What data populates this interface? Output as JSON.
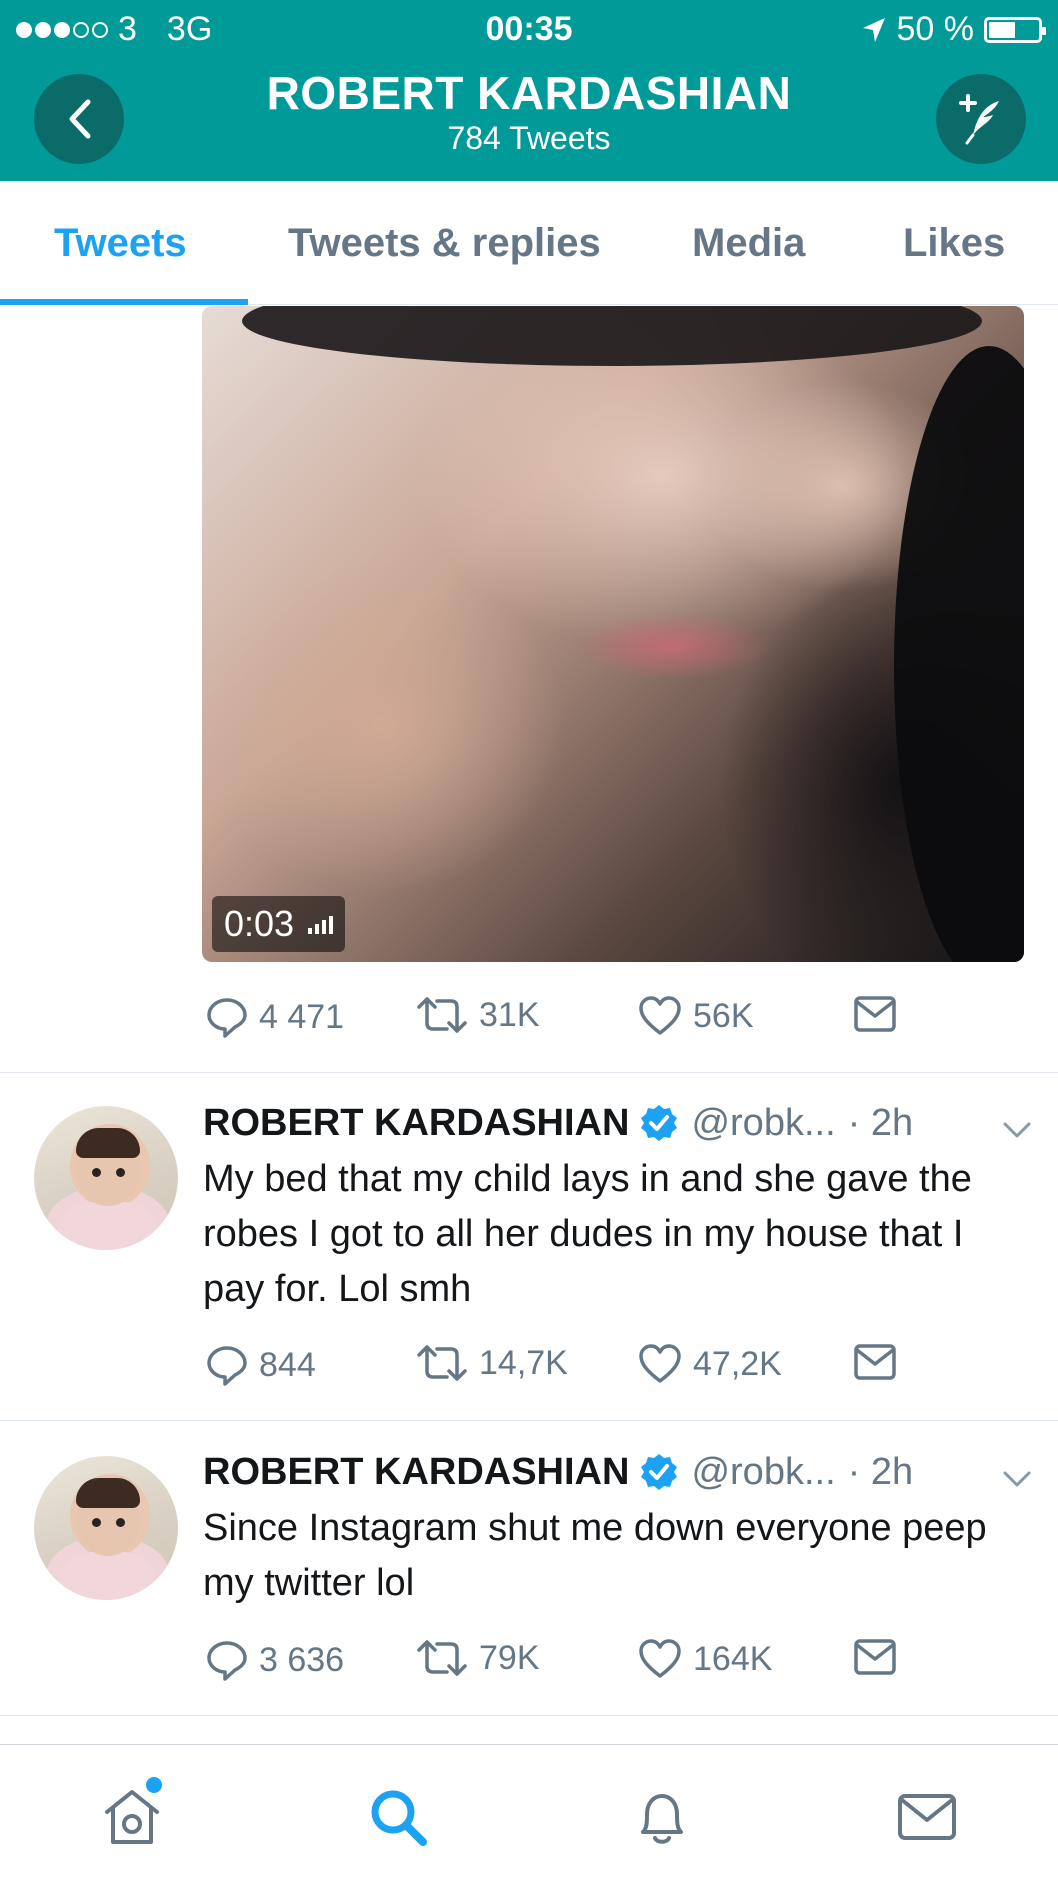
{
  "status_bar": {
    "carrier": "3",
    "network": "3G",
    "time": "00:35",
    "battery": "50 %",
    "battery_level": 0.5
  },
  "header": {
    "title": "ROBERT KARDASHIAN",
    "subtitle": "784 Tweets",
    "back_icon": "chevron-left-icon",
    "compose_icon": "compose-feather-icon"
  },
  "tabs": [
    {
      "label": "Tweets",
      "active": true
    },
    {
      "label": "Tweets & replies",
      "active": false
    },
    {
      "label": "Media",
      "active": false
    },
    {
      "label": "Likes",
      "active": false
    }
  ],
  "media_tweet": {
    "video_duration": "0:03",
    "stats": {
      "replies": "4 471",
      "retweets": "31K",
      "likes": "56K"
    }
  },
  "tweets": [
    {
      "name": "ROBERT KARDASHIAN",
      "handle": "@robk...",
      "time": "· 2h",
      "text": "My bed that my child lays in and she gave the robes I got to all her dudes in my house that I pay for. Lol smh",
      "stats": {
        "replies": "844",
        "retweets": "14,7K",
        "likes": "47,2K"
      }
    },
    {
      "name": "ROBERT KARDASHIAN",
      "handle": "@robk...",
      "time": "· 2h",
      "text": "Since Instagram shut me down everyone peep my twitter lol",
      "stats": {
        "replies": "3 636",
        "retweets": "79K",
        "likes": "164K"
      }
    }
  ],
  "bottom_nav": [
    {
      "icon": "home-icon",
      "active": false,
      "has_badge": true
    },
    {
      "icon": "search-icon",
      "active": true,
      "has_badge": false
    },
    {
      "icon": "bell-icon",
      "active": false,
      "has_badge": false
    },
    {
      "icon": "mail-icon",
      "active": false,
      "has_badge": false
    }
  ],
  "colors": {
    "header_bg": "#009b98",
    "accent": "#1da1f2",
    "secondary_text": "#657786",
    "verified": "#1da1f2"
  }
}
